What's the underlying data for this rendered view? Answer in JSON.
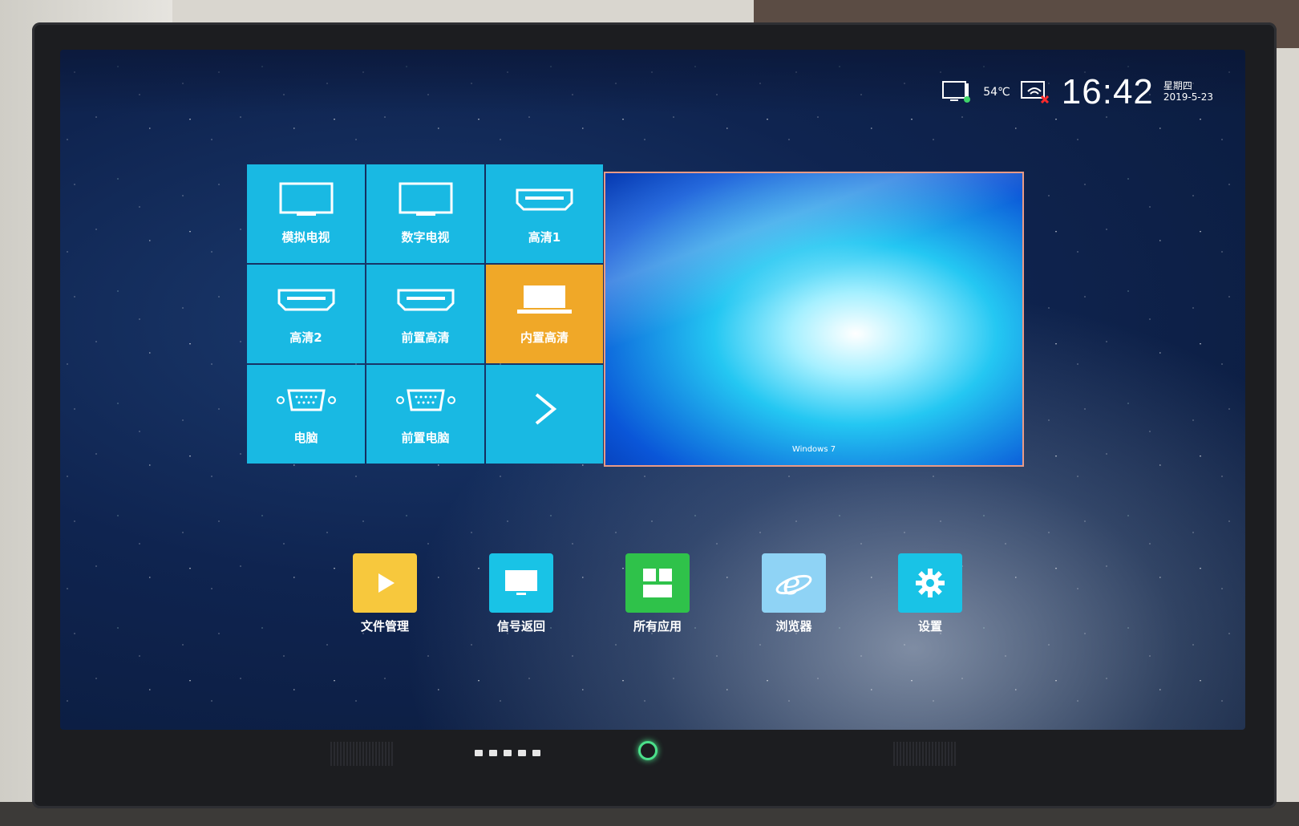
{
  "status": {
    "temperature": "54℃",
    "time": "16:42",
    "weekday": "星期四",
    "date": "2019-5-23",
    "icons": [
      "thermometer-screen-icon",
      "wifi-screen-disconnected-icon"
    ]
  },
  "source_tiles": [
    {
      "label": "模拟电视",
      "icon": "tv-icon"
    },
    {
      "label": "数字电视",
      "icon": "tv-icon"
    },
    {
      "label": "高清1",
      "icon": "hdmi-icon"
    },
    {
      "label": "高清2",
      "icon": "hdmi-icon"
    },
    {
      "label": "前置高清",
      "icon": "hdmi-icon"
    },
    {
      "label": "内置高清",
      "icon": "laptop-icon",
      "selected": true
    },
    {
      "label": "电脑",
      "icon": "vga-icon"
    },
    {
      "label": "前置电脑",
      "icon": "vga-icon"
    },
    {
      "label": "",
      "icon": "chevron-right-icon"
    }
  ],
  "preview": {
    "caption": "Windows 7"
  },
  "dock": [
    {
      "label": "文件管理",
      "icon": "file-manager-icon",
      "color": "#f7c83d"
    },
    {
      "label": "信号返回",
      "icon": "signal-return-icon",
      "color": "#19c3e6"
    },
    {
      "label": "所有应用",
      "icon": "all-apps-icon",
      "color": "#2fc24a"
    },
    {
      "label": "浏览器",
      "icon": "browser-icon",
      "color": "#8fd3f5"
    },
    {
      "label": "设置",
      "icon": "settings-icon",
      "color": "#19c3e6"
    }
  ],
  "colors": {
    "tile": "#19b9e3",
    "tile_selected": "#f0a828",
    "power_led": "#4be08a"
  }
}
